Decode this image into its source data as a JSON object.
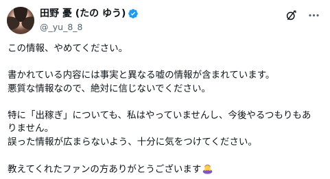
{
  "user": {
    "display_name": "田野 憂 (たの ゆう)",
    "handle": "@_yu_8_8",
    "verified": true,
    "verified_color": "#1d9bf0"
  },
  "actions": {
    "grok_icon": "grok-slash-icon",
    "more_icon": "more-dots-icon"
  },
  "tweet": {
    "line1": "この情報、やめてください。",
    "line2": "書かれている内容には事実と異なる嘘の情報が含まれています。",
    "line3": "悪質な情報なので、絶対に信じないでください。",
    "line4": "特に「出稼ぎ」についても、私はやっていませんし、今後やるつもりもあ",
    "line5": "りません。",
    "line6": "誤った情報が広まらないよう、十分に気をつけてください。",
    "line7": "教えてくれたファンの方ありがとうございます",
    "emoji": "person-bowing-emoji"
  }
}
